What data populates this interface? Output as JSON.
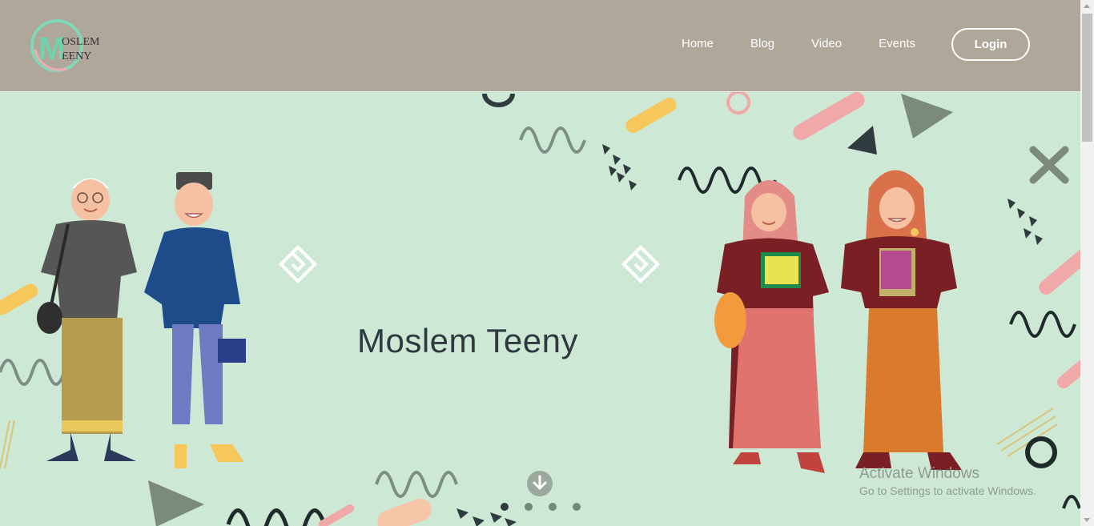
{
  "header": {
    "logo_text_line1": "OSLEM",
    "logo_text_line2": "EENY",
    "logo_letter": "M",
    "nav": [
      {
        "label": "Home"
      },
      {
        "label": "Blog"
      },
      {
        "label": "Video"
      },
      {
        "label": "Events"
      }
    ],
    "login_label": "Login"
  },
  "hero": {
    "title": "Moslem Teeny",
    "carousel_dots": 4,
    "active_dot": 1
  },
  "watermark": {
    "title": "Activate Windows",
    "subtitle": "Go to Settings to activate Windows."
  },
  "colors": {
    "header_bg": "#aea79a",
    "hero_bg": "#cde9d6",
    "title": "#2e3a3f",
    "accent_pink": "#f1a8a8",
    "accent_yellow": "#f6c75a"
  }
}
